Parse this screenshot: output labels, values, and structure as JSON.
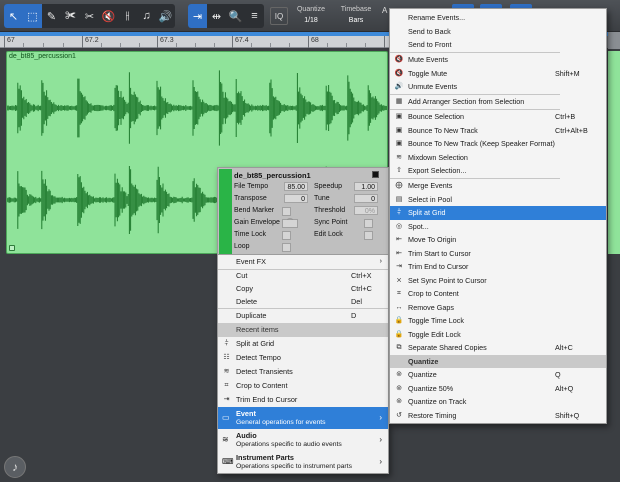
{
  "toolbar": {
    "iq_label": "IQ",
    "quantize_label": "Quantize",
    "quantize_value": "1/18",
    "timebase_label": "Timebase",
    "timebase_value": "Bars",
    "extra_label": "A"
  },
  "ruler": {
    "labels": [
      "67",
      "67.2",
      "67.3",
      "67.4",
      "68",
      "",
      ""
    ]
  },
  "event": {
    "name": "de_bt85_percussion1",
    "color": "#8fe39a"
  },
  "inspector": {
    "title": "de_bt85_percussion1",
    "file_tempo_label": "File Tempo",
    "file_tempo_value": "85.00",
    "speedup_label": "Speedup",
    "speedup_value": "1.00",
    "transpose_label": "Transpose",
    "transpose_value": "0",
    "tune_label": "Tune",
    "tune_value": "0",
    "bend_marker_label": "Bend Marker",
    "threshold_label": "Threshold",
    "threshold_value": "0%",
    "gain_envelope_label": "Gain Envelope",
    "sync_point_label": "Sync Point",
    "time_lock_label": "Time Lock",
    "edit_lock_label": "Edit Lock",
    "loop_label": "Loop"
  },
  "context_menu": {
    "items": [
      {
        "label": "Event FX",
        "shortcut": "",
        "arrow": "›"
      },
      {
        "label": "Cut",
        "shortcut": "Ctrl+X"
      },
      {
        "label": "Copy",
        "shortcut": "Ctrl+C"
      },
      {
        "label": "Delete",
        "shortcut": "Del"
      },
      {
        "label": "Duplicate",
        "shortcut": "D"
      }
    ],
    "recent_header": "Recent items",
    "recent": [
      "Split at Grid",
      "Detect Tempo",
      "Detect Transients",
      "Crop to Content",
      "Trim End to Cursor"
    ],
    "submenus": [
      {
        "title": "Event",
        "subtitle": "General operations for events",
        "arrow": "›"
      },
      {
        "title": "Audio",
        "subtitle": "Operations specific to audio events",
        "arrow": "›"
      },
      {
        "title": "Instrument Parts",
        "subtitle": "Operations specific to instrument parts",
        "arrow": "›"
      }
    ]
  },
  "event_submenu": {
    "items": [
      {
        "label": "Rename Events...",
        "shortcut": ""
      },
      {
        "label": "Send to Back",
        "shortcut": ""
      },
      {
        "label": "Send to Front",
        "shortcut": ""
      },
      {
        "label": "Mute Events",
        "shortcut": ""
      },
      {
        "label": "Toggle Mute",
        "shortcut": "Shift+M"
      },
      {
        "label": "Unmute Events",
        "shortcut": ""
      },
      {
        "label": "Add Arranger Section from Selection",
        "shortcut": ""
      },
      {
        "label": "Bounce Selection",
        "shortcut": "Ctrl+B"
      },
      {
        "label": "Bounce To New Track",
        "shortcut": "Ctrl+Alt+B"
      },
      {
        "label": "Bounce To New Track (Keep Speaker Format)",
        "shortcut": ""
      },
      {
        "label": "Mixdown Selection",
        "shortcut": ""
      },
      {
        "label": "Export Selection...",
        "shortcut": ""
      },
      {
        "label": "Merge Events",
        "shortcut": ""
      },
      {
        "label": "Select in Pool",
        "shortcut": ""
      },
      {
        "label": "Split at Grid",
        "shortcut": ""
      },
      {
        "label": "Spot...",
        "shortcut": ""
      },
      {
        "label": "Move To Origin",
        "shortcut": ""
      },
      {
        "label": "Trim Start to Cursor",
        "shortcut": ""
      },
      {
        "label": "Trim End to Cursor",
        "shortcut": ""
      },
      {
        "label": "Set Sync Point to Cursor",
        "shortcut": ""
      },
      {
        "label": "Crop to Content",
        "shortcut": ""
      },
      {
        "label": "Remove Gaps",
        "shortcut": ""
      },
      {
        "label": "Toggle Time Lock",
        "shortcut": ""
      },
      {
        "label": "Toggle Edit Lock",
        "shortcut": ""
      },
      {
        "label": "Separate Shared Copies",
        "shortcut": "Alt+C"
      }
    ],
    "quantize_header": "Quantize",
    "quantize_items": [
      {
        "label": "Quantize",
        "shortcut": "Q"
      },
      {
        "label": "Quantize 50%",
        "shortcut": "Alt+Q"
      },
      {
        "label": "Quantize on Track",
        "shortcut": ""
      },
      {
        "label": "Restore Timing",
        "shortcut": "Shift+Q"
      }
    ]
  }
}
